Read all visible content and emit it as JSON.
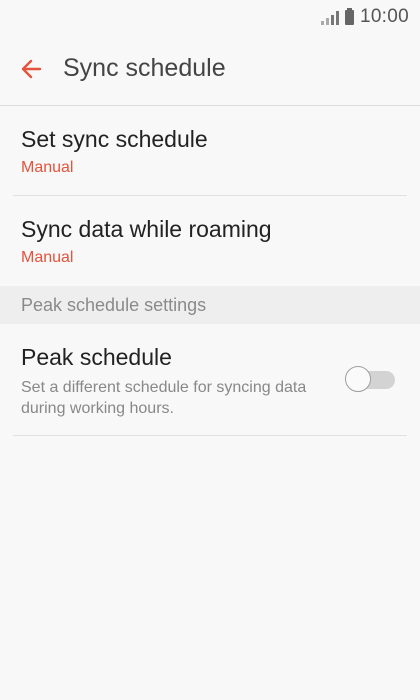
{
  "status_bar": {
    "time": "10:00"
  },
  "app_bar": {
    "title": "Sync schedule",
    "back_icon": "arrow-left-icon",
    "accent_color": "#e4533c"
  },
  "settings": {
    "items": [
      {
        "title": "Set sync schedule",
        "value": "Manual"
      },
      {
        "title": "Sync data while roaming",
        "value": "Manual"
      }
    ],
    "section_header": "Peak schedule settings",
    "peak": {
      "title": "Peak schedule",
      "description": "Set a different schedule for syncing data during working hours.",
      "enabled": false
    }
  },
  "colors": {
    "accent": "#e4533c",
    "background": "#f8f8f8",
    "section_header_bg": "#eeeeee"
  }
}
